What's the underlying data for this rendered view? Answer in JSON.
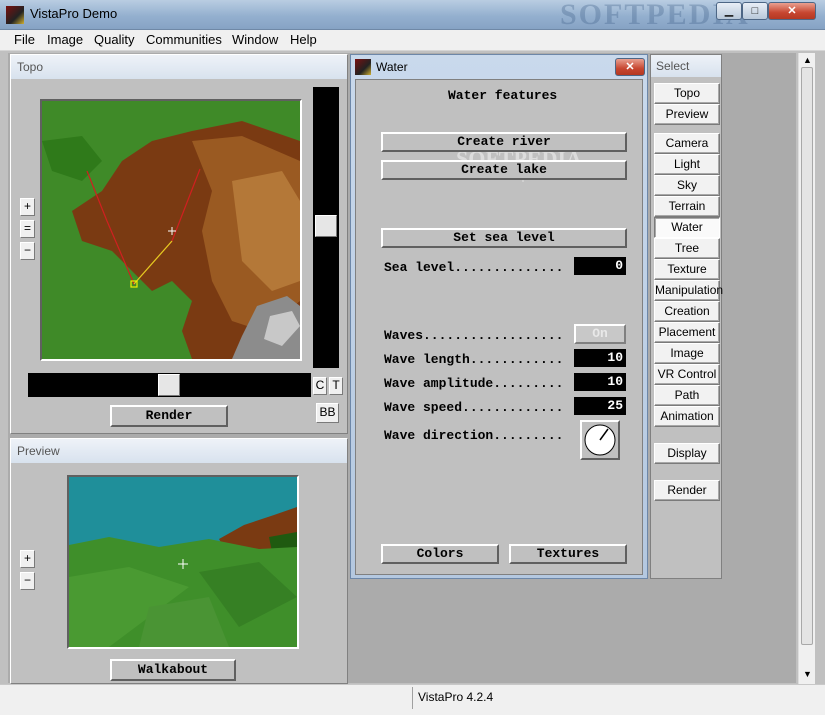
{
  "app": {
    "title": "VistaPro Demo",
    "watermark": "SOFTPEDIA"
  },
  "window_buttons": {
    "minimize": "▁",
    "maximize": "□",
    "close": "✕"
  },
  "menu": [
    "File",
    "Image",
    "Quality",
    "Communities",
    "Window",
    "Help"
  ],
  "topo": {
    "header": "Topo",
    "zoom_in": "+",
    "zoom_reset": "=",
    "zoom_out": "−",
    "c_label": "C",
    "t_label": "T",
    "bb_label": "BB",
    "render_label": "Render",
    "vertical_slider_level": 0.5,
    "horizontal_slider_level": 0.5
  },
  "preview": {
    "header": "Preview",
    "zoom_in": "+",
    "zoom_out": "−",
    "walkabout_label": "Walkabout"
  },
  "water": {
    "title": "Water",
    "heading": "Water features",
    "create_river": "Create river",
    "create_lake": "Create lake",
    "set_sea_level": "Set sea level",
    "sea_level": {
      "label": "Sea level..............",
      "value": "0"
    },
    "waves": {
      "label": "Waves..................",
      "value": "On"
    },
    "wave_length": {
      "label": "Wave length............",
      "value": "10"
    },
    "wave_amplitude": {
      "label": "Wave amplitude.........",
      "value": "10"
    },
    "wave_speed": {
      "label": "Wave speed.............",
      "value": "25"
    },
    "wave_direction": {
      "label": "Wave direction........."
    },
    "colors": "Colors",
    "textures": "Textures",
    "watermark": "SOFTPEDIA",
    "watermark_url": "www.softpedia.com"
  },
  "select": {
    "header": "Select",
    "group1": [
      "Topo",
      "Preview"
    ],
    "group2": [
      "Camera",
      "Light",
      "Sky",
      "Terrain",
      "Water",
      "Tree",
      "Texture",
      "Manipulation",
      "Creation",
      "Placement",
      "Image",
      "VR Control",
      "Path",
      "Animation"
    ],
    "active": "Water",
    "display": "Display",
    "render": "Render"
  },
  "status": {
    "text": "VistaPro 4.2.4"
  },
  "colors": {
    "sky": "#1f8f9a",
    "grass": "#3f8f2a",
    "terrain": "#8a4a18",
    "title_active": "#b9cde2"
  }
}
